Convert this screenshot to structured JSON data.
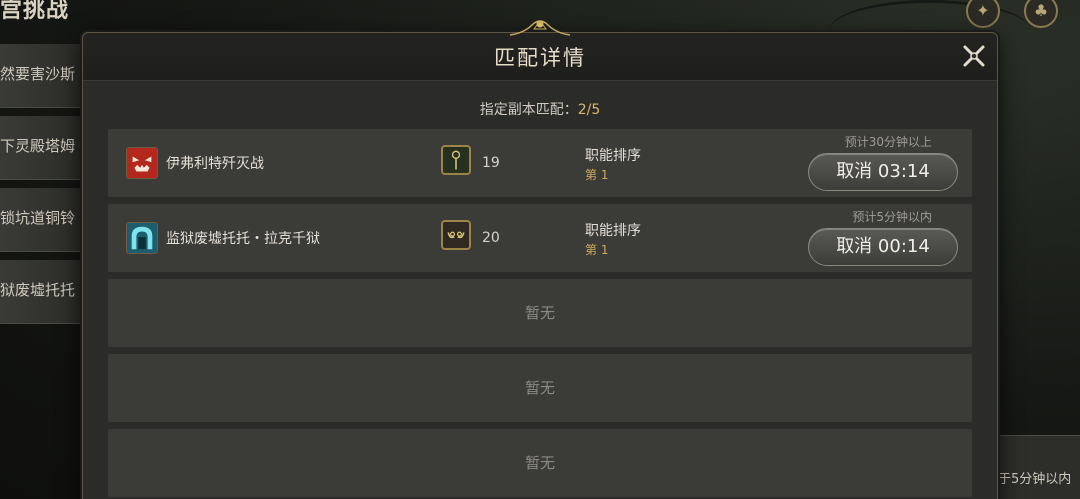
{
  "background": {
    "title": "宫挑战",
    "list": [
      "然要害沙斯",
      "下灵殿塔姆",
      "锁坑道铜铃",
      "狱废墟托托"
    ],
    "corner_text": "于5分钟以内"
  },
  "dialog": {
    "title": "匹配详情",
    "summary_label": "指定副本匹配：",
    "summary_value": "2/5",
    "queues": [
      {
        "dungeon": "伊弗利特歼灭战",
        "dungeon_icon": "ifrit-icon",
        "role_icon": "healer-staff-icon",
        "count": "19",
        "sort_label": "职能排序",
        "sort_value": "第 1",
        "eta": "预计30分钟以上",
        "cancel_label": "取消 03:14"
      },
      {
        "dungeon": "监狱废墟托托・拉克千狱",
        "dungeon_icon": "prison-ruins-icon",
        "role_icon": "dps-horns-icon",
        "count": "20",
        "sort_label": "职能排序",
        "sort_value": "第 1",
        "eta": "预计5分钟以内",
        "cancel_label": "取消 00:14"
      }
    ],
    "empty_slots": [
      "暂无",
      "暂无",
      "暂无"
    ]
  },
  "colors": {
    "accent_gold": "#d9b96a",
    "panel": "#2b2b29",
    "row": "#3b3b38"
  }
}
